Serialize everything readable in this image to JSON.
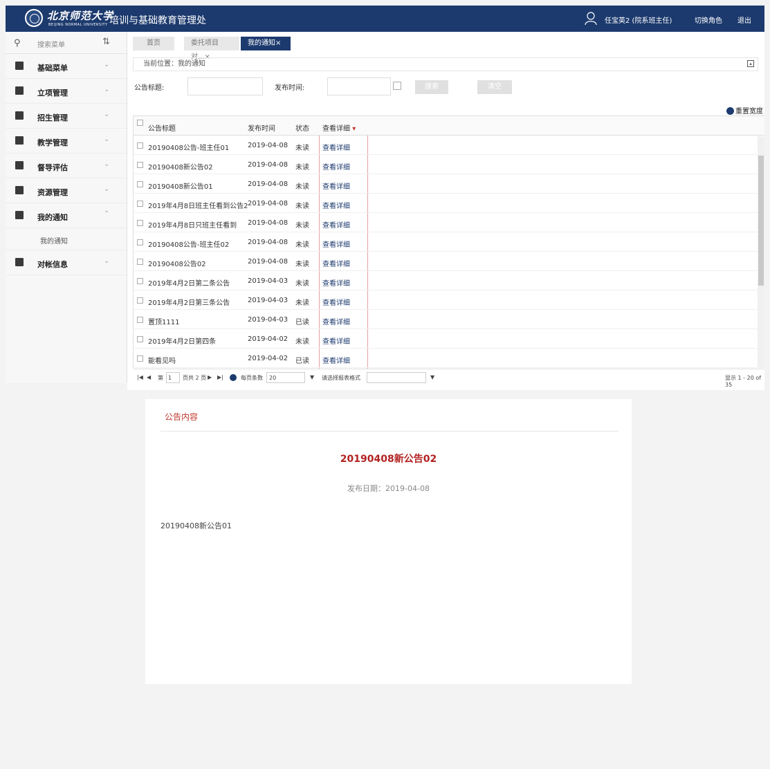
{
  "header": {
    "logo_cn": "北京师范大学",
    "logo_en": "BEIJING NORMAL UNIVERSITY",
    "system_title": "培训与基础教育管理处",
    "user_name": "任宝英2 (院系班主任)",
    "switch_role": "切换角色",
    "logout": "退出"
  },
  "sidebar": {
    "search_placeholder": "搜索菜单",
    "menus": [
      {
        "label": "基础菜单",
        "icon": "list-icon"
      },
      {
        "label": "立项管理",
        "icon": "layers-icon"
      },
      {
        "label": "招生管理",
        "icon": "badge-icon"
      },
      {
        "label": "教学管理",
        "icon": "book-icon"
      },
      {
        "label": "督导评估",
        "icon": "pen-icon"
      },
      {
        "label": "资源管理",
        "icon": "folder-icon"
      },
      {
        "label": "我的通知",
        "icon": "speaker-icon",
        "expanded": true
      },
      {
        "label": "对帐信息",
        "icon": "pen-icon"
      }
    ],
    "submenu_item": "我的通知"
  },
  "tabs": [
    "首页",
    "委托项目对...×",
    "我的通知×"
  ],
  "location": "当前位置：我的通知",
  "filter": {
    "title_label": "公告标题:",
    "time_label": "发布时间:",
    "search_button": "搜索",
    "clear_button": "清空"
  },
  "reset_width": "重置宽度",
  "grid": {
    "columns": [
      "公告标题",
      "发布时间",
      "状态",
      "查看详细"
    ],
    "rows": [
      {
        "title": "20190408公告-班主任01",
        "date": "2019-04-08",
        "status": "未读",
        "action": "查看详细"
      },
      {
        "title": "20190408新公告02",
        "date": "2019-04-08",
        "status": "未读",
        "action": "查看详细"
      },
      {
        "title": "20190408新公告01",
        "date": "2019-04-08",
        "status": "未读",
        "action": "查看详细"
      },
      {
        "title": "2019年4月8日班主任看到公告2",
        "date": "2019-04-08",
        "status": "未读",
        "action": "查看详细"
      },
      {
        "title": "2019年4月8日只班主任看到",
        "date": "2019-04-08",
        "status": "未读",
        "action": "查看详细"
      },
      {
        "title": "20190408公告-班主任02",
        "date": "2019-04-08",
        "status": "未读",
        "action": "查看详细"
      },
      {
        "title": "20190408公告02",
        "date": "2019-04-08",
        "status": "未读",
        "action": "查看详细"
      },
      {
        "title": "2019年4月2日第二条公告",
        "date": "2019-04-03",
        "status": "未读",
        "action": "查看详细"
      },
      {
        "title": "2019年4月2日第三条公告",
        "date": "2019-04-03",
        "status": "未读",
        "action": "查看详细"
      },
      {
        "title": "置顶1111",
        "date": "2019-04-03",
        "status": "已读",
        "action": "查看详细"
      },
      {
        "title": "2019年4月2日第四条",
        "date": "2019-04-02",
        "status": "未读",
        "action": "查看详细"
      },
      {
        "title": "能看见吗",
        "date": "2019-04-02",
        "status": "已读",
        "action": "查看详细"
      }
    ]
  },
  "pager": {
    "page_prefix": "第",
    "page_value": "1",
    "page_suffix": "页共 2 页",
    "per_page_label": "每页条数",
    "per_page_value": "20",
    "export_label": "请选择报表格式",
    "summary": "显示 1 - 20 of 35"
  },
  "detail": {
    "header": "公告内容",
    "title": "20190408新公告02",
    "publish_date": "发布日期：2019-04-08",
    "body": "20190408新公告01"
  },
  "colors": {
    "brand": "#1c3a6e",
    "title_red": "#b22222",
    "header_red": "#c0392b"
  }
}
